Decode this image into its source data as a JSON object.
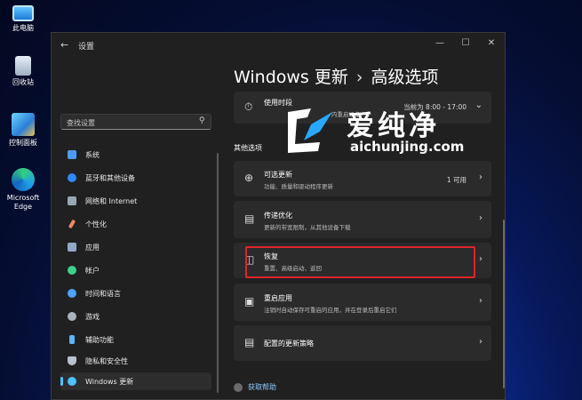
{
  "desktop": {
    "icons": [
      {
        "label": "此电脑",
        "icon": "computer-icon"
      },
      {
        "label": "回收站",
        "icon": "recycle-bin-icon"
      },
      {
        "label": "控制面板",
        "icon": "control-panel-icon"
      },
      {
        "label": "Microsoft Edge",
        "icon": "edge-icon"
      }
    ]
  },
  "window": {
    "title": "设置",
    "back_icon": "back-arrow-icon",
    "controls": {
      "minimize": "—",
      "maximize": "☐",
      "close": "✕"
    }
  },
  "sidebar": {
    "search_placeholder": "查找设置",
    "items": [
      {
        "label": "系统",
        "icon": "system-icon",
        "color": "#4c9bff"
      },
      {
        "label": "蓝牙和其他设备",
        "icon": "bluetooth-icon",
        "color": "#2f88ff"
      },
      {
        "label": "网络和 Internet",
        "icon": "network-icon",
        "color": "#9aa6b5"
      },
      {
        "label": "个性化",
        "icon": "brush-icon",
        "color": "#f08a5d"
      },
      {
        "label": "应用",
        "icon": "apps-icon",
        "color": "#8fa9c8"
      },
      {
        "label": "帐户",
        "icon": "account-icon",
        "color": "#3fcf8e"
      },
      {
        "label": "时间和语言",
        "icon": "globe-clock-icon",
        "color": "#4da3ff"
      },
      {
        "label": "游戏",
        "icon": "gamepad-icon",
        "color": "#aab3bd"
      },
      {
        "label": "辅助功能",
        "icon": "accessibility-icon",
        "color": "#5fb4ff"
      },
      {
        "label": "隐私和安全性",
        "icon": "shield-icon",
        "color": "#b9c2cc"
      },
      {
        "label": "Windows 更新",
        "icon": "windows-update-icon",
        "color": "#4cc2ff",
        "active": true
      }
    ]
  },
  "main": {
    "breadcrumb": {
      "parent": "Windows 更新",
      "separator": "›",
      "current": "高级选项"
    },
    "active_hours": {
      "title": "使用时段",
      "subtitle": "内重启设备",
      "value": "当前为 8:00 - 17:00"
    },
    "section_label": "其他选项",
    "cards": [
      {
        "title": "可选更新",
        "subtitle": "功能、质量和驱动程序更新",
        "right": "1 可用",
        "icon": "plus-circle-icon"
      },
      {
        "title": "传递优化",
        "subtitle": "更新的带宽限制，从其他设备下载",
        "right": "",
        "icon": "delivery-icon"
      },
      {
        "title": "恢复",
        "subtitle": "重置、高级启动、返回",
        "right": "",
        "icon": "recovery-icon"
      },
      {
        "title": "重启应用",
        "subtitle": "注销时自动保存可重启的应用，并在登录后重启它们",
        "right": "",
        "icon": "restart-apps-icon"
      },
      {
        "title": "配置的更新策略",
        "subtitle": "",
        "right": "",
        "icon": "policy-icon"
      }
    ],
    "help_link": "获取帮助"
  },
  "watermark": {
    "cn": "爱纯净",
    "en": "aichunjing.com"
  },
  "colors": {
    "accent": "#4cc2ff",
    "highlight": "#e0242a",
    "card": "#2b2b2b",
    "window": "#202020"
  }
}
